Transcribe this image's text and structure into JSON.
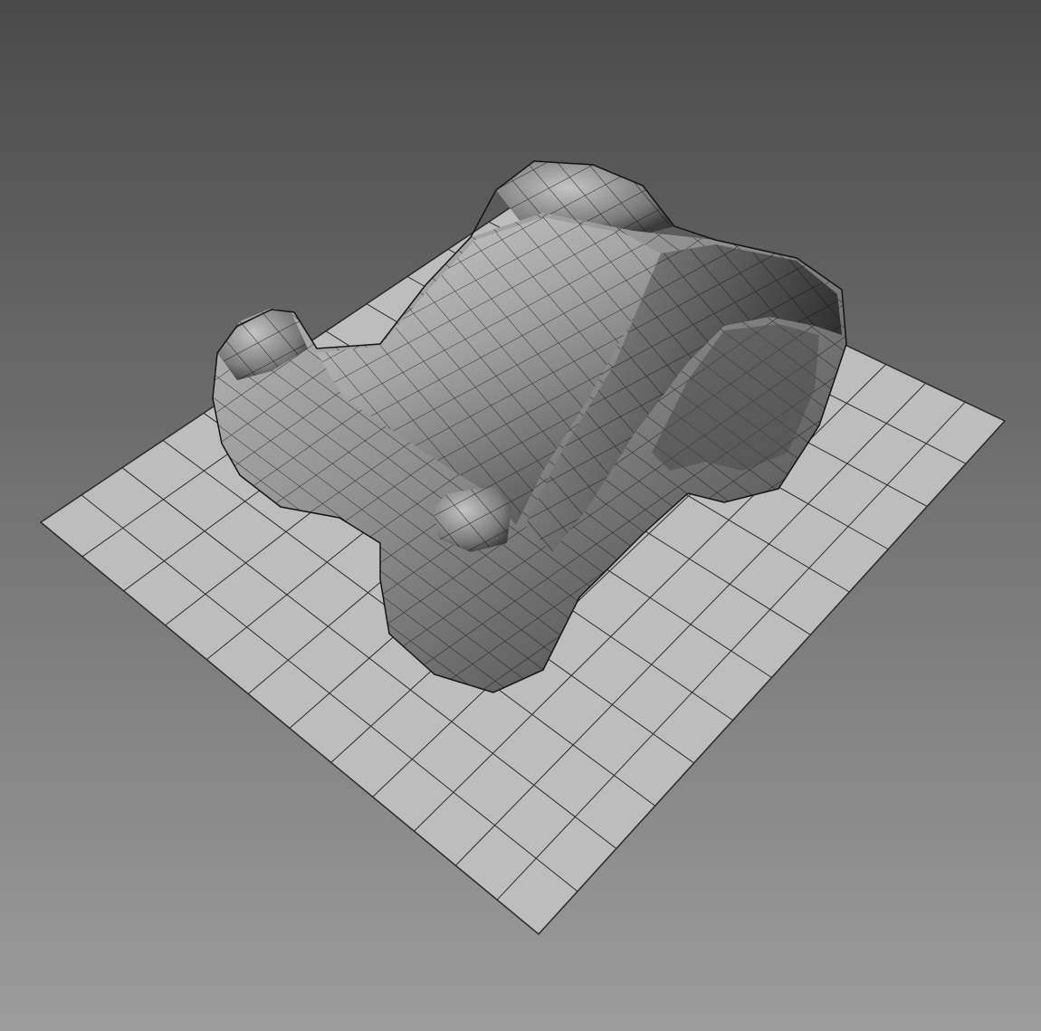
{
  "viewport": {
    "view": "perspective",
    "shading": "smooth-shaded-with-wireframe",
    "colors": {
      "background_top": "#4a4a4a",
      "background_bottom": "#9c9c9c",
      "grid_fill": "#bdbdbd",
      "grid_lines": "#2a2a2a",
      "mesh_light": "#c8c8c8",
      "mesh_mid": "#8a8a8a",
      "mesh_dark": "#2e2e2e",
      "wireframe": "#111111"
    },
    "grid": {
      "divisions_u": 12,
      "divisions_v": 12
    },
    "objects": [
      {
        "name": "sculpted-mesh",
        "icon": "polygon-mesh-icon"
      }
    ]
  }
}
